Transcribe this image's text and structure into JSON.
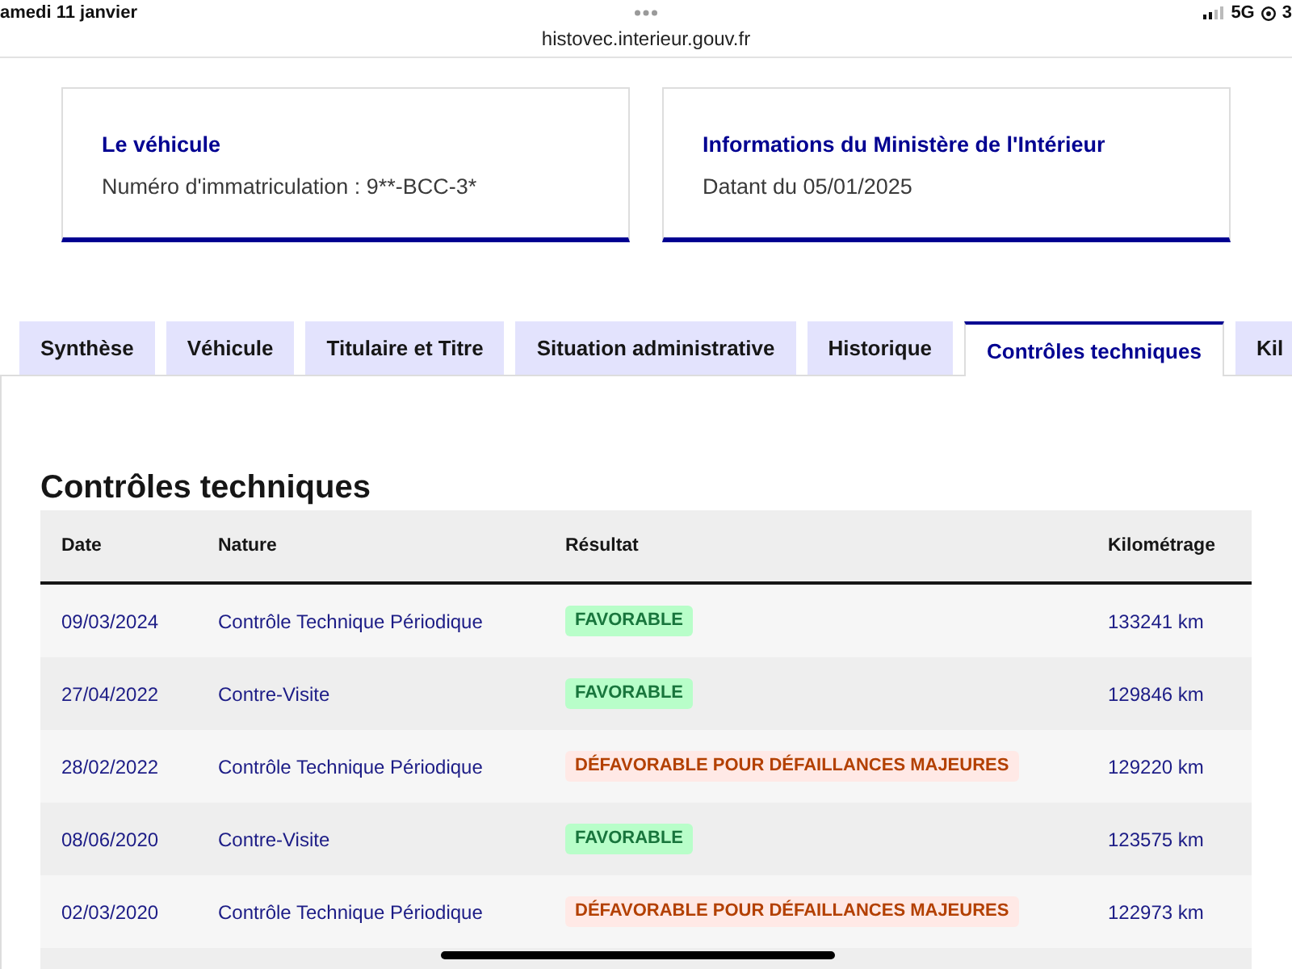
{
  "status_bar": {
    "date": "amedi 11 janvier",
    "network": "5G",
    "battery": "3"
  },
  "browser": {
    "url": "histovec.interieur.gouv.fr"
  },
  "cards": [
    {
      "title": "Le véhicule",
      "text": "Numéro d'immatriculation : 9**-BCC-3*"
    },
    {
      "title": "Informations du Ministère de l'Intérieur",
      "text": "Datant du 05/01/2025"
    }
  ],
  "tabs": [
    {
      "label": "Synthèse",
      "selected": false
    },
    {
      "label": "Véhicule",
      "selected": false
    },
    {
      "label": "Titulaire et Titre",
      "selected": false
    },
    {
      "label": "Situation administrative",
      "selected": false
    },
    {
      "label": "Historique",
      "selected": false
    },
    {
      "label": "Contrôles techniques",
      "selected": true
    },
    {
      "label": "Kil",
      "selected": false
    }
  ],
  "section": {
    "title": "Contrôles techniques"
  },
  "table": {
    "columns": [
      "Date",
      "Nature",
      "Résultat",
      "Kilométrage"
    ],
    "rows": [
      {
        "date": "09/03/2024",
        "nature": "Contrôle Technique Périodique",
        "result": {
          "label": "FAVORABLE",
          "kind": "success"
        },
        "mileage": "133241 km"
      },
      {
        "date": "27/04/2022",
        "nature": "Contre-Visite",
        "result": {
          "label": "FAVORABLE",
          "kind": "success"
        },
        "mileage": "129846 km"
      },
      {
        "date": "28/02/2022",
        "nature": "Contrôle Technique Périodique",
        "result": {
          "label": "DÉFAVORABLE POUR DÉFAILLANCES MAJEURES",
          "kind": "error"
        },
        "mileage": "129220 km"
      },
      {
        "date": "08/06/2020",
        "nature": "Contre-Visite",
        "result": {
          "label": "FAVORABLE",
          "kind": "success"
        },
        "mileage": "123575 km"
      },
      {
        "date": "02/03/2020",
        "nature": "Contrôle Technique Périodique",
        "result": {
          "label": "DÉFAVORABLE POUR DÉFAILLANCES MAJEURES",
          "kind": "error"
        },
        "mileage": "122973 km"
      }
    ]
  }
}
